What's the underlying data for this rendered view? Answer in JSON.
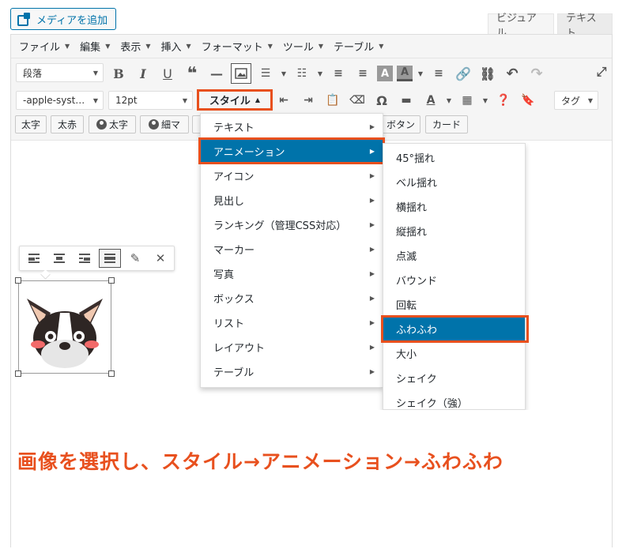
{
  "media_button": {
    "label": "メディアを追加"
  },
  "editor_tabs": {
    "visual": "ビジュアル",
    "text": "テキスト"
  },
  "menubar": [
    "ファイル",
    "編集",
    "表示",
    "挿入",
    "フォーマット",
    "ツール",
    "テーブル"
  ],
  "toolbar": {
    "format_select": "段落",
    "font_family_select": "-apple-syst…",
    "font_size_select": "12pt",
    "style_button": "スタイル",
    "tag_select": "タグ"
  },
  "custom_buttons": [
    "太字",
    "太赤",
    "太字",
    "細マ",
    "ボタン",
    "カード"
  ],
  "style_menu": {
    "items": [
      "テキスト",
      "アニメーション",
      "アイコン",
      "見出し",
      "ランキング（管理CSS対応）",
      "マーカー",
      "写真",
      "ボックス",
      "リスト",
      "レイアウト",
      "テーブル"
    ],
    "selected": "アニメーション"
  },
  "animation_menu": {
    "items": [
      "45°揺れ",
      "ベル揺れ",
      "横揺れ",
      "縦揺れ",
      "点滅",
      "バウンド",
      "回転",
      "ふわふわ",
      "大小",
      "シェイク",
      "シェイク（強）"
    ],
    "selected": "ふわふわ"
  },
  "instruction": "画像を選択し、スタイル→アニメーション→ふわふわ",
  "colors": {
    "accent": "#0073aa",
    "highlight": "#e8501e"
  }
}
